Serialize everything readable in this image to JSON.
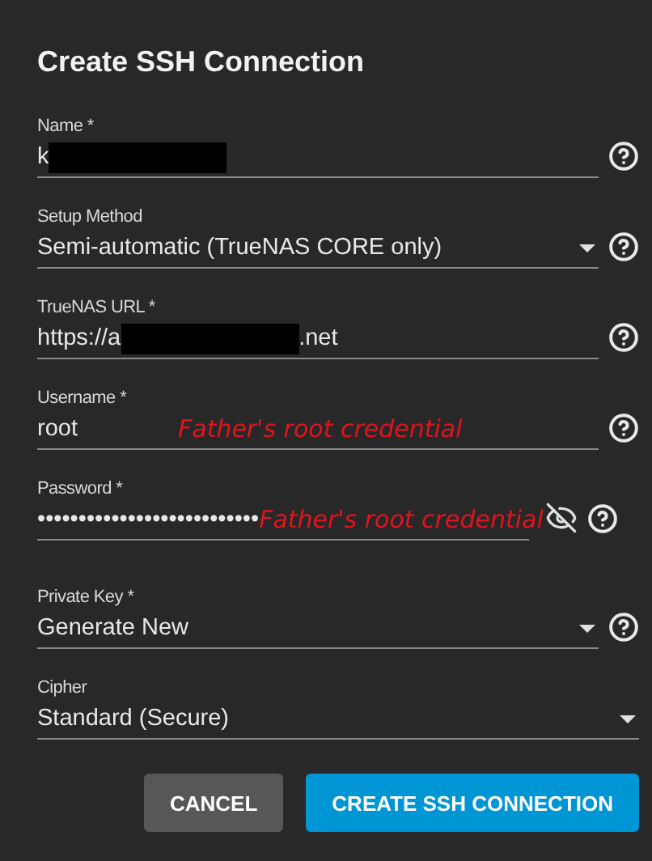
{
  "dialog": {
    "title": "Create SSH Connection"
  },
  "fields": [
    {
      "kind": "text",
      "label": "Name *",
      "value": "k",
      "redacted": true,
      "help": true
    },
    {
      "kind": "select",
      "label": "Setup Method",
      "value": "Semi-automatic (TrueNAS CORE only)",
      "help": true
    },
    {
      "kind": "text",
      "label": "TrueNAS URL *",
      "value": "https://a",
      "redacted": true,
      "value_end": ".net",
      "help": true
    },
    {
      "kind": "text",
      "label": "Username *",
      "value": "root",
      "annotation": "Father's root credential",
      "help": true
    },
    {
      "kind": "password",
      "label": "Password *",
      "value": "•••••••••••••••••••••••••••",
      "annotation": "Father's root credential",
      "help": true
    },
    {
      "kind": "select",
      "label": "Private Key *",
      "value": "Generate New",
      "help": true
    },
    {
      "kind": "select",
      "label": "Cipher",
      "value": "Standard (Secure)",
      "help": false
    }
  ],
  "buttons": [
    {
      "label": "CANCEL",
      "kind": "secondary"
    },
    {
      "label": "CREATE SSH CONNECTION",
      "kind": "primary"
    }
  ]
}
